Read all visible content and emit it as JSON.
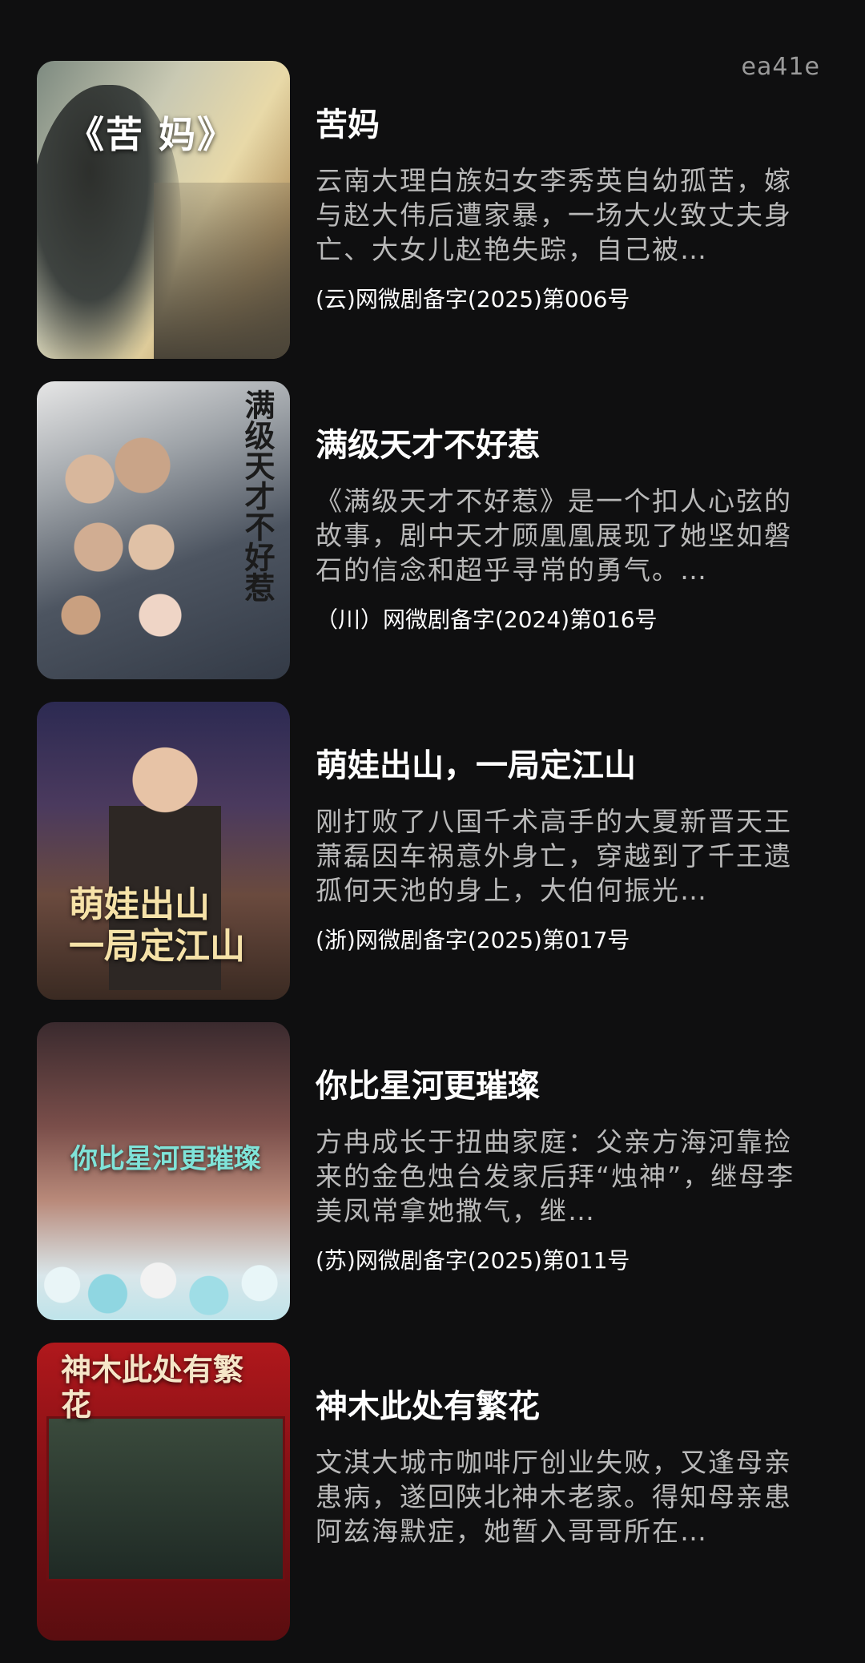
{
  "header": {
    "corner_tag": "ea41e"
  },
  "dramas": [
    {
      "poster_text": "《苦 妈》",
      "title": "苦妈",
      "description": "云南大理白族妇女李秀英自幼孤苦，嫁与赵大伟后遭家暴，一场大火致丈夫身亡、大女儿赵艳失踪，自己被…",
      "license": "(云)网微剧备字(2025)第006号"
    },
    {
      "poster_text": "满级天才不好惹",
      "title": "满级天才不好惹",
      "description": "《满级天才不好惹》是一个扣人心弦的故事，剧中天才顾凰凰展现了她坚如磐石的信念和超乎寻常的勇气。…",
      "license": "（川）网微剧备字(2024)第016号"
    },
    {
      "poster_text": "萌娃出山 一局定江山",
      "title": "萌娃出山，一局定江山",
      "description": "刚打败了八国千术高手的大夏新晋天王萧磊因车祸意外身亡，穿越到了千王遗孤何天池的身上，大伯何振光…",
      "license": "(浙)网微剧备字(2025)第017号"
    },
    {
      "poster_text": "你比星河更璀璨",
      "title": "你比星河更璀璨",
      "description": "方冉成长于扭曲家庭：父亲方海河靠捡来的金色烛台发家后拜“烛神”，继母李美凤常拿她撒气，继…",
      "license": "(苏)网微剧备字(2025)第011号"
    },
    {
      "poster_text": "神木此处有繁花",
      "title": "神木此处有繁花",
      "description": "文淇大城市咖啡厅创业失败，又逢母亲患病，遂回陕北神木老家。得知母亲患阿兹海默症，她暂入哥哥所在…",
      "license": ""
    }
  ]
}
